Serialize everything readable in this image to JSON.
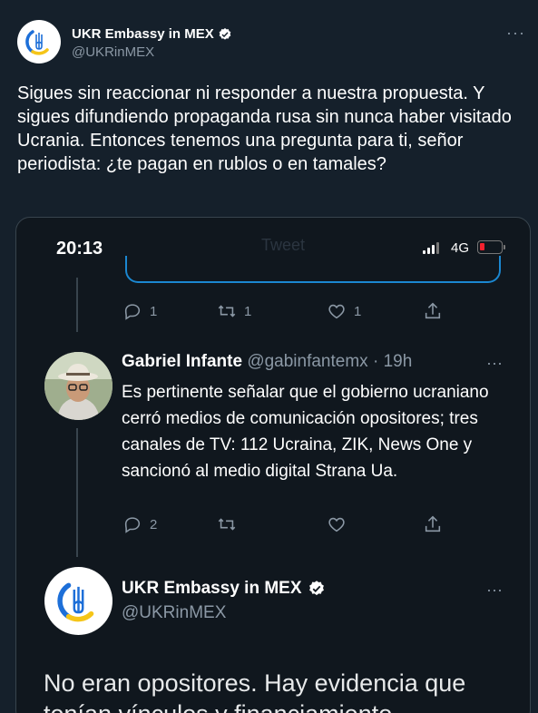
{
  "tweet": {
    "author_name": "UKR Embassy in MEX",
    "author_handle": "@UKRinMEX",
    "more_label": "···",
    "text": "Sigues sin reaccionar ni responder a nuestra propuesta. Y sigues difundiendo propaganda rusa sin nunca haber visitado Ucrania. Entonces tenemos una pregunta para ti, señor periodista: ¿te pagan en rublos o en tamales?"
  },
  "screenshot": {
    "status_time": "20:13",
    "network": "4G",
    "faded_title": "Tweet",
    "first_actions": {
      "reply_count": "1",
      "retweet_count": "1",
      "like_count": "1"
    },
    "reply": {
      "name": "Gabriel Infante",
      "handle": "@gabinfantemx",
      "time": "· 19h",
      "more_label": "···",
      "text": "Es pertinente señalar que el gobierno ucraniano cerró medios de comunicación opositores;  tres canales de TV: 112 Ucraina, ZIK, News One y sancionó al medio digital Strana Ua.",
      "reply_count": "2"
    },
    "quoted": {
      "name": "UKR Embassy in MEX",
      "handle": "@UKRinMEX",
      "more_label": "···",
      "text": "No eran opositores. Hay evidencia que tenían vínculos y financiamiento"
    }
  },
  "colors": {
    "background": "#15202b",
    "accent": "#1d9bf0",
    "muted": "#8b98a5",
    "verified": "#ffffff"
  }
}
